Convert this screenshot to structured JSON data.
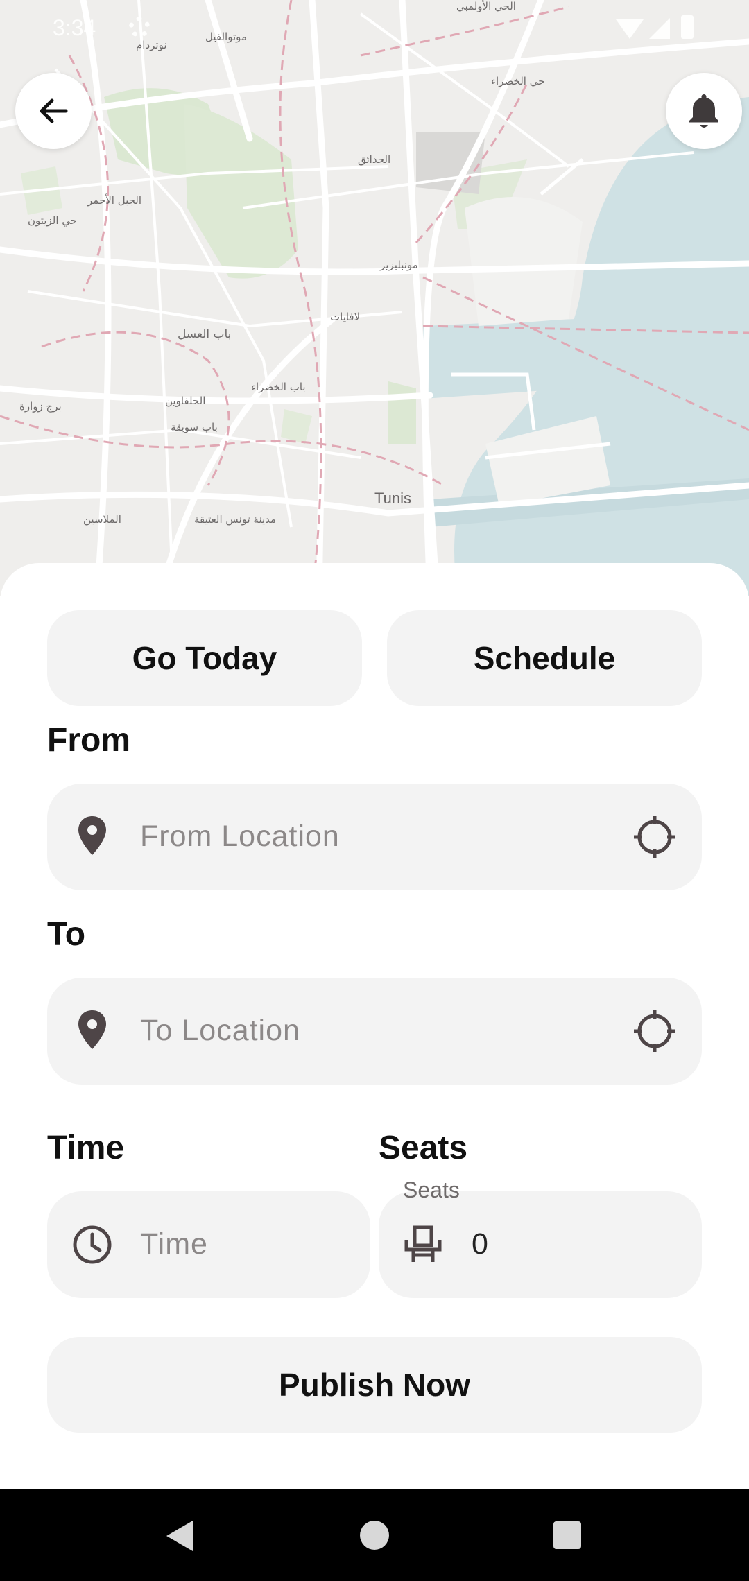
{
  "status_bar": {
    "time": "3:34"
  },
  "map": {
    "labels": {
      "noutrdam": "نوتردام",
      "moutouafil": "موتوالفيل",
      "hay_khadra": "حي الخضراء",
      "hadaek": "الحدائق",
      "jebel_ahmar": "الجبل الأحمر",
      "hay_zitoun": "حي الزيتون",
      "montplaisir": "مونبليزير",
      "lafayette": "لافايات",
      "bab_assal": "باب العسل",
      "bab_khadra": "باب الخضراء",
      "halfaouine": "الحلفاوين",
      "borj_zouara": "برج زوارة",
      "bab_souika": "باب سويقة",
      "tunis": "Tunis",
      "mellassine": "الملاسين",
      "medina": "مدينة تونس العتيقة",
      "top_label": "الحي الأولمبي"
    },
    "colors": {
      "land": "#efeeec",
      "water": "#cfe1e4",
      "park": "#dbe8d2",
      "road": "#ffffff",
      "boundary": "#e0a8b4"
    }
  },
  "buttons": {
    "back_icon": "arrow-left-icon",
    "bell_icon": "bell-icon",
    "go_today": "Go Today",
    "schedule": "Schedule",
    "publish": "Publish Now"
  },
  "form": {
    "from_label": "From",
    "from_placeholder": "From Location",
    "to_label": "To",
    "to_placeholder": "To Location",
    "time_label": "Time",
    "time_placeholder": "Time",
    "seats_label": "Seats",
    "seats_floating_label": "Seats",
    "seats_value": "0"
  },
  "colors": {
    "field_bg": "#f3f3f3",
    "icon": "#4e4547",
    "text": "#111111",
    "placeholder": "#8c8888"
  }
}
